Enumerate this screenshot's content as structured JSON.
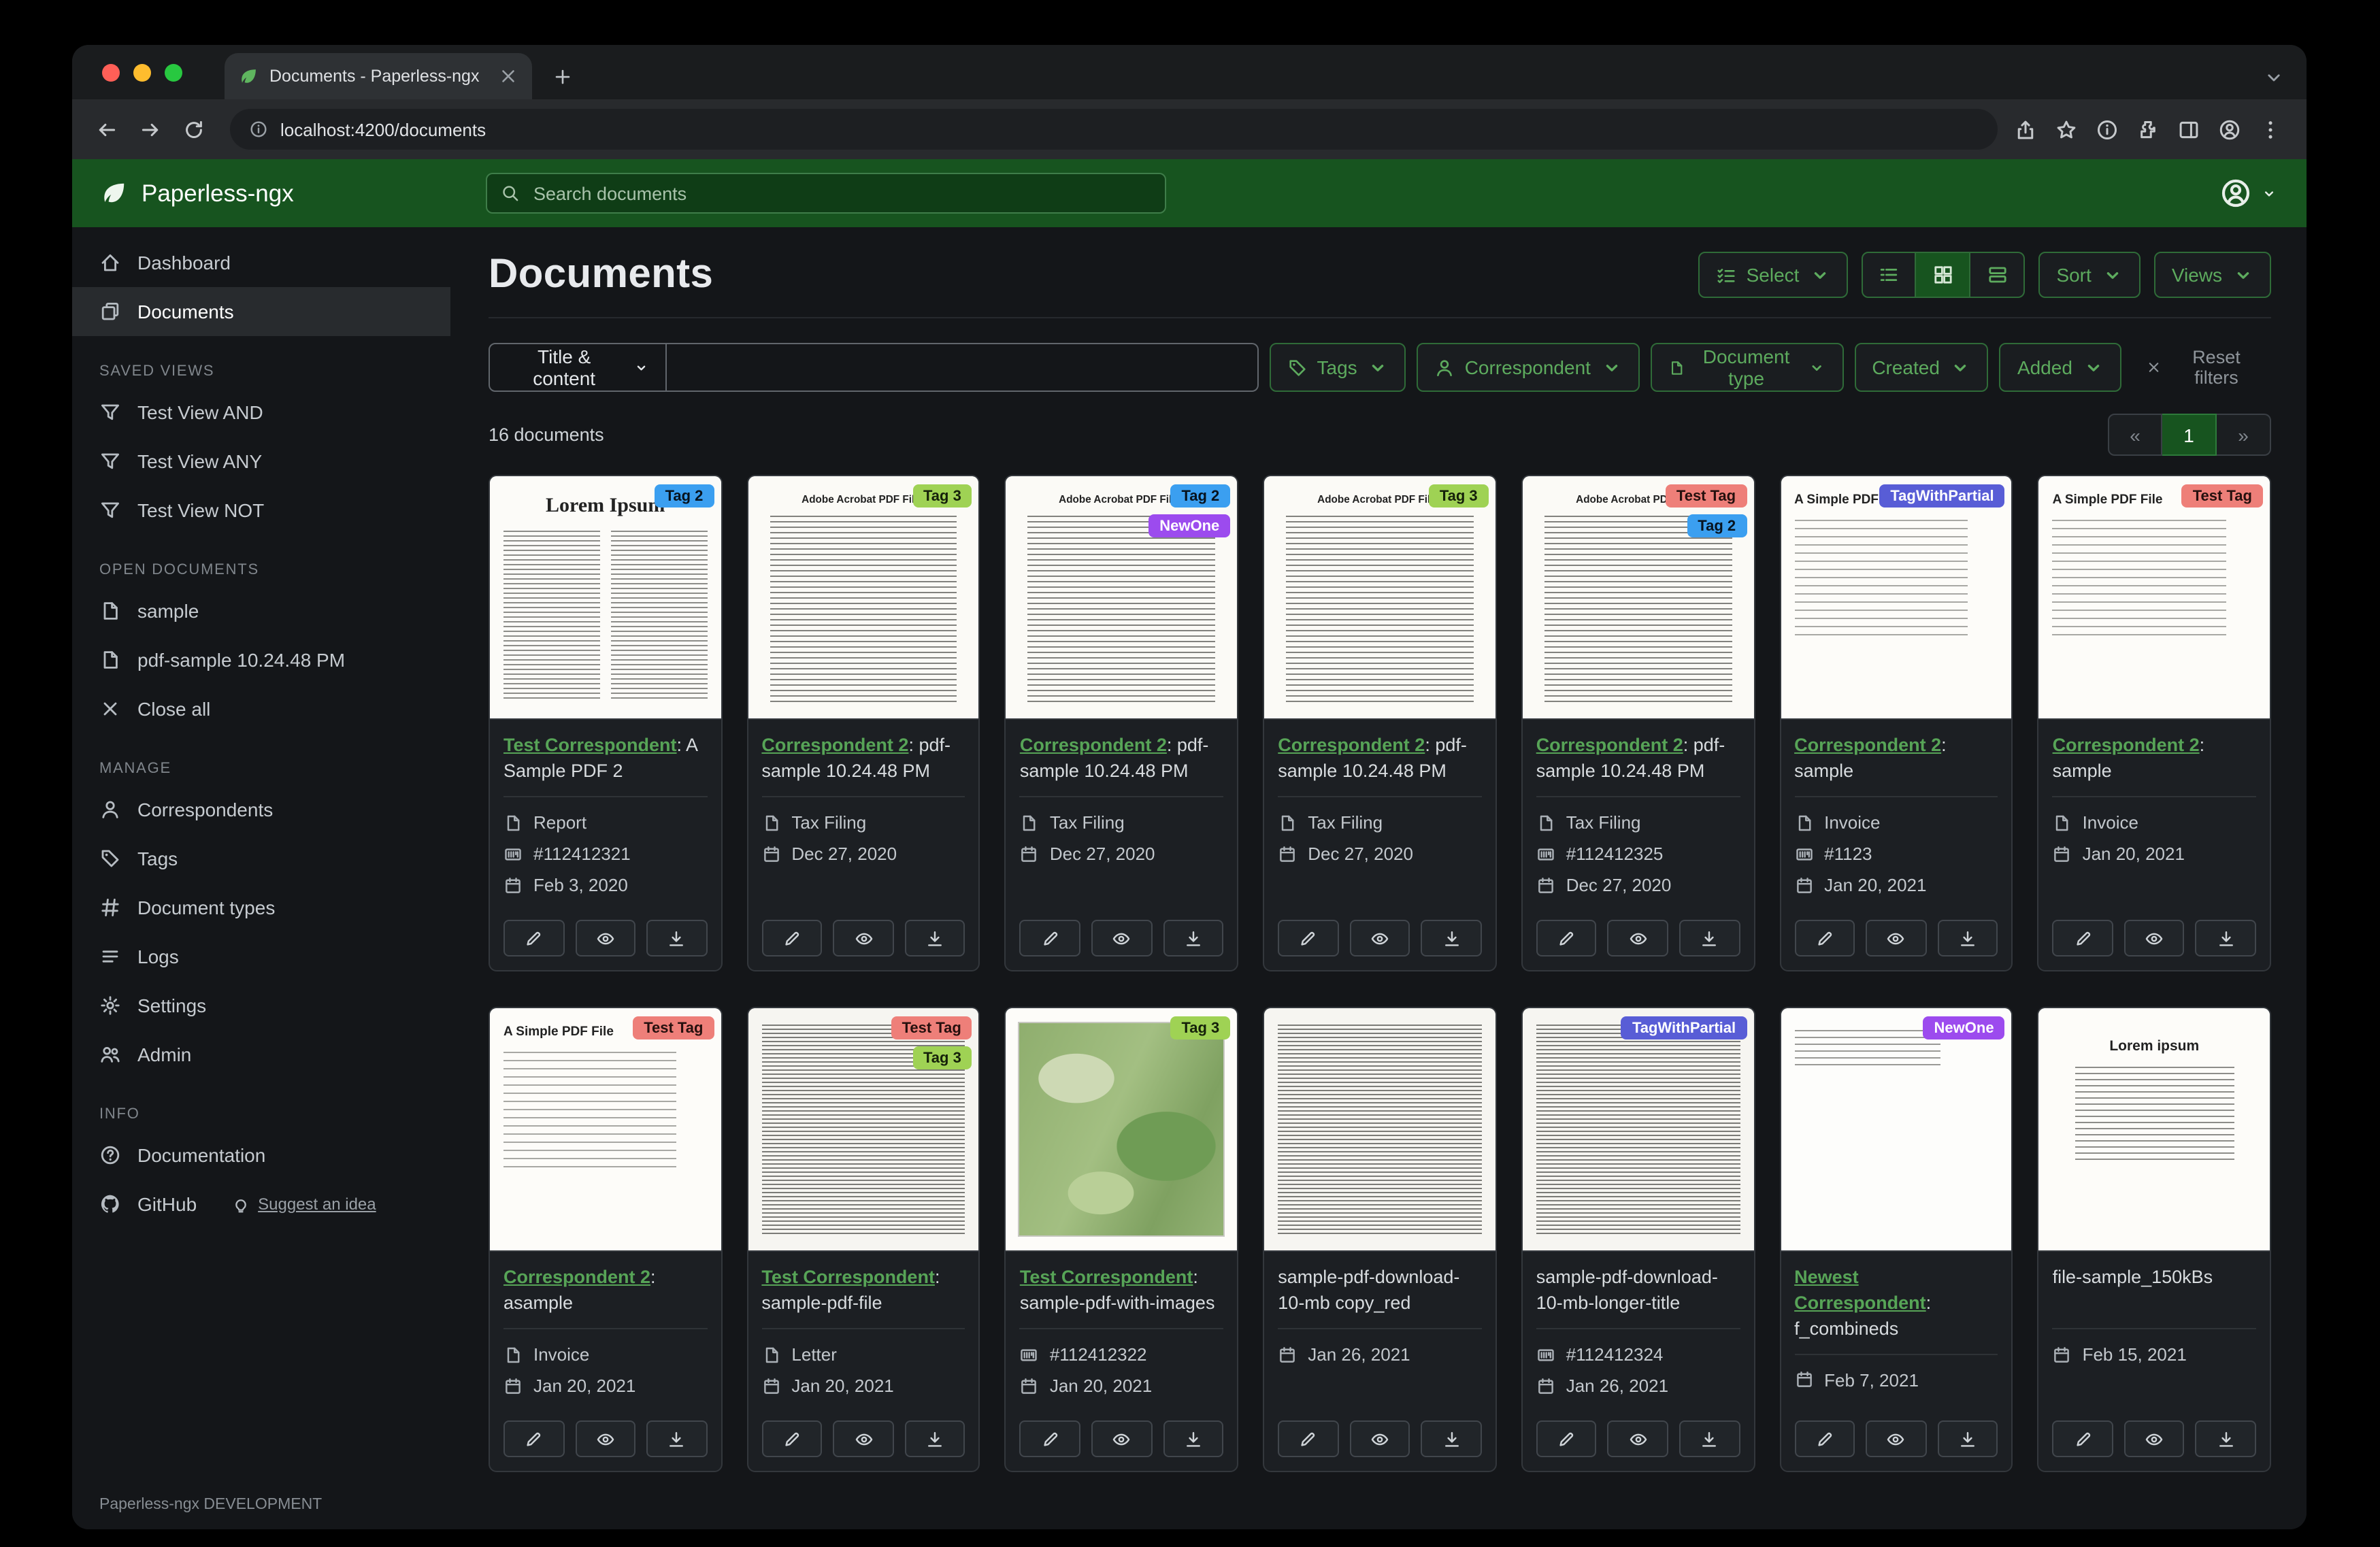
{
  "browser": {
    "tab_title": "Documents - Paperless-ngx",
    "url": "localhost:4200/documents"
  },
  "header": {
    "brand": "Paperless-ngx",
    "search_placeholder": "Search documents"
  },
  "sidebar": {
    "primary": [
      {
        "label": "Dashboard",
        "icon": "home",
        "active": false
      },
      {
        "label": "Documents",
        "icon": "documents",
        "active": true
      }
    ],
    "sections": [
      {
        "label": "SAVED VIEWS",
        "items": [
          {
            "label": "Test View AND",
            "icon": "filter"
          },
          {
            "label": "Test View ANY",
            "icon": "filter"
          },
          {
            "label": "Test View NOT",
            "icon": "filter"
          }
        ]
      },
      {
        "label": "OPEN DOCUMENTS",
        "items": [
          {
            "label": "sample",
            "icon": "file"
          },
          {
            "label": "pdf-sample 10.24.48 PM",
            "icon": "file"
          },
          {
            "label": "Close all",
            "icon": "close"
          }
        ]
      },
      {
        "label": "MANAGE",
        "items": [
          {
            "label": "Correspondents",
            "icon": "user"
          },
          {
            "label": "Tags",
            "icon": "tag"
          },
          {
            "label": "Document types",
            "icon": "hash"
          },
          {
            "label": "Logs",
            "icon": "list"
          },
          {
            "label": "Settings",
            "icon": "gear"
          },
          {
            "label": "Admin",
            "icon": "users"
          }
        ]
      },
      {
        "label": "INFO",
        "items": [
          {
            "label": "Documentation",
            "icon": "question"
          },
          {
            "label": "GitHub",
            "icon": "github",
            "extra": {
              "label": "Suggest an idea",
              "icon": "bulb"
            }
          }
        ]
      }
    ],
    "footer": "Paperless-ngx DEVELOPMENT"
  },
  "main": {
    "title": "Documents",
    "count": "16 documents",
    "controls": {
      "select": "Select",
      "sort": "Sort",
      "views": "Views"
    },
    "filter": {
      "field_label": "Title & content",
      "pills": [
        {
          "label": "Tags",
          "icon": "tag"
        },
        {
          "label": "Correspondent",
          "icon": "user"
        },
        {
          "label": "Document type",
          "icon": "file"
        },
        {
          "label": "Created",
          "icon": ""
        },
        {
          "label": "Added",
          "icon": ""
        }
      ],
      "reset": "Reset filters"
    },
    "pagination": {
      "prev": "«",
      "page": "1",
      "next": "»"
    }
  },
  "accent_colors": {
    "header_green": "#17541f",
    "link_green": "#57a457",
    "button_green": "#5dab5e"
  },
  "tag_styles": {
    "Tag 2": {
      "bg": "#3b9ff0",
      "fg": "#07131f"
    },
    "Tag 3": {
      "bg": "#9fd254",
      "fg": "#15210a"
    },
    "NewOne": {
      "bg": "#9c4bee",
      "fg": "#ffffff"
    },
    "Test Tag": {
      "bg": "#ee7f79",
      "fg": "#26100e"
    },
    "TagWithPartial": {
      "bg": "#585dd6",
      "fg": "#ffffff"
    }
  },
  "cards": [
    {
      "correspondent": "Test Correspondent",
      "rest": ": A Sample PDF 2",
      "tags": [
        "Tag 2"
      ],
      "meta": [
        [
          "doctype",
          "Report"
        ],
        [
          "asn",
          "#112412321"
        ],
        [
          "date",
          "Feb 3, 2020"
        ]
      ],
      "thumb": {
        "variant": "lorem",
        "title": "Lorem Ipsum"
      }
    },
    {
      "correspondent": "Correspondent 2",
      "rest": ": pdf-sample 10.24.48 PM",
      "tags": [
        "Tag 3"
      ],
      "meta": [
        [
          "doctype",
          "Tax Filing"
        ],
        [
          "date",
          "Dec 27, 2020"
        ]
      ],
      "thumb": {
        "variant": "acrobat",
        "title": "Adobe Acrobat PDF Files"
      }
    },
    {
      "correspondent": "Correspondent 2",
      "rest": ": pdf-sample 10.24.48 PM",
      "tags": [
        "Tag 2",
        "NewOne"
      ],
      "meta": [
        [
          "doctype",
          "Tax Filing"
        ],
        [
          "date",
          "Dec 27, 2020"
        ]
      ],
      "thumb": {
        "variant": "acrobat",
        "title": "Adobe Acrobat PDF Files"
      }
    },
    {
      "correspondent": "Correspondent 2",
      "rest": ": pdf-sample 10.24.48 PM",
      "tags": [
        "Tag 3"
      ],
      "meta": [
        [
          "doctype",
          "Tax Filing"
        ],
        [
          "date",
          "Dec 27, 2020"
        ]
      ],
      "thumb": {
        "variant": "acrobat",
        "title": "Adobe Acrobat PDF Files"
      }
    },
    {
      "correspondent": "Correspondent 2",
      "rest": ": pdf-sample 10.24.48 PM",
      "tags": [
        "Test Tag",
        "Tag 2"
      ],
      "meta": [
        [
          "doctype",
          "Tax Filing"
        ],
        [
          "asn",
          "#112412325"
        ],
        [
          "date",
          "Dec 27, 2020"
        ]
      ],
      "thumb": {
        "variant": "acrobat",
        "title": "Adobe Acrobat PDF Files"
      }
    },
    {
      "correspondent": "Correspondent 2",
      "rest": ": sample",
      "tags": [
        "TagWithPartial"
      ],
      "meta": [
        [
          "doctype",
          "Invoice"
        ],
        [
          "asn",
          "#1123"
        ],
        [
          "date",
          "Jan 20, 2021"
        ]
      ],
      "thumb": {
        "variant": "simple",
        "title": "A Simple PDF File"
      }
    },
    {
      "correspondent": "Correspondent 2",
      "rest": ": sample",
      "tags": [
        "Test Tag"
      ],
      "meta": [
        [
          "doctype",
          "Invoice"
        ],
        [
          "date",
          "Jan 20, 2021"
        ]
      ],
      "thumb": {
        "variant": "simple",
        "title": "A Simple PDF File"
      }
    },
    {
      "correspondent": "Correspondent 2",
      "rest": ": asample",
      "tags": [
        "Test Tag"
      ],
      "meta": [
        [
          "doctype",
          "Invoice"
        ],
        [
          "date",
          "Jan 20, 2021"
        ]
      ],
      "thumb": {
        "variant": "simple",
        "title": "A Simple PDF File"
      }
    },
    {
      "correspondent": "Test Correspondent",
      "rest": ": sample-pdf-file",
      "tags": [
        "Test Tag",
        "Tag 3"
      ],
      "meta": [
        [
          "doctype",
          "Letter"
        ],
        [
          "date",
          "Jan 20, 2021"
        ]
      ],
      "thumb": {
        "variant": "dense",
        "title": ""
      }
    },
    {
      "correspondent": "Test Correspondent",
      "rest": ": sample-pdf-with-images",
      "tags": [
        "Tag 3"
      ],
      "meta": [
        [
          "asn",
          "#112412322"
        ],
        [
          "date",
          "Jan 20, 2021"
        ]
      ],
      "thumb": {
        "variant": "map",
        "title": ""
      }
    },
    {
      "correspondent": null,
      "rest": "sample-pdf-download-10-mb copy_red",
      "tags": [],
      "meta": [
        [
          "date",
          "Jan 26, 2021"
        ]
      ],
      "thumb": {
        "variant": "dense",
        "title": ""
      }
    },
    {
      "correspondent": null,
      "rest": "sample-pdf-download-10-mb-longer-title",
      "tags": [
        "TagWithPartial"
      ],
      "meta": [
        [
          "asn",
          "#112412324"
        ],
        [
          "date",
          "Jan 26, 2021"
        ]
      ],
      "thumb": {
        "variant": "dense",
        "title": ""
      }
    },
    {
      "correspondent": "Newest Correspondent",
      "rest": ": f_combineds",
      "tags": [
        "NewOne"
      ],
      "meta": [
        [
          "date",
          "Feb 7, 2021"
        ]
      ],
      "thumb": {
        "variant": "sparse",
        "title": ""
      }
    },
    {
      "correspondent": null,
      "rest": "file-sample_150kBs",
      "tags": [],
      "meta": [
        [
          "date",
          "Feb 15, 2021"
        ]
      ],
      "thumb": {
        "variant": "lorem_center",
        "title": "Lorem ipsum"
      }
    }
  ]
}
